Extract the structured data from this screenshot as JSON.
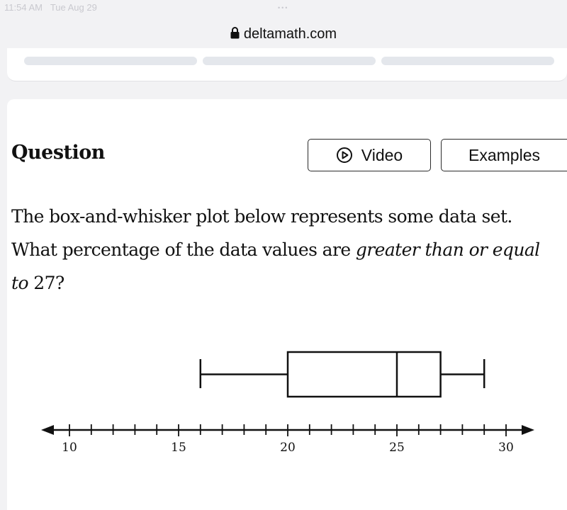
{
  "status_bar": {
    "time": "11:54 AM",
    "date": "Tue Aug 29",
    "dots": "•••"
  },
  "browser": {
    "url": "deltamath.com",
    "lock_icon": "lock-icon"
  },
  "question": {
    "title": "Question",
    "video_label": "Video",
    "examples_label": "Examples",
    "text_part1": "The box-and-whisker plot below represents some data set. What percentage of the data values are ",
    "text_italic": "greater than or equal to",
    "text_number": "27",
    "text_end": "?"
  },
  "chart_data": {
    "type": "boxplot",
    "min": 16,
    "q1": 20,
    "median": 25,
    "q3": 27,
    "max": 29,
    "axis_min": 10,
    "axis_max": 30,
    "tick_step": 1,
    "tick_labels": [
      10,
      15,
      20,
      25,
      30
    ]
  }
}
